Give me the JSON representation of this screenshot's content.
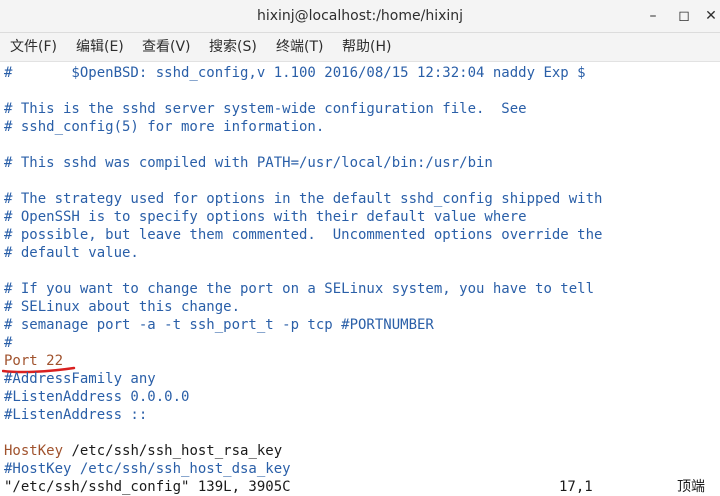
{
  "window": {
    "title": "hixinj@localhost:/home/hixinj",
    "minimize_glyph": "–",
    "maximize_glyph": "◻",
    "close_glyph": "✕"
  },
  "menu": {
    "items": [
      {
        "label": "文件(F)"
      },
      {
        "label": "编辑(E)"
      },
      {
        "label": "查看(V)"
      },
      {
        "label": "搜索(S)"
      },
      {
        "label": "终端(T)"
      },
      {
        "label": "帮助(H)"
      }
    ]
  },
  "editor": {
    "lines": [
      {
        "kind": "comment",
        "text": "#       $OpenBSD: sshd_config,v 1.100 2016/08/15 12:32:04 naddy Exp $"
      },
      {
        "kind": "blank",
        "text": ""
      },
      {
        "kind": "comment",
        "text": "# This is the sshd server system-wide configuration file.  See"
      },
      {
        "kind": "comment",
        "text": "# sshd_config(5) for more information."
      },
      {
        "kind": "blank",
        "text": ""
      },
      {
        "kind": "comment",
        "text": "# This sshd was compiled with PATH=/usr/local/bin:/usr/bin"
      },
      {
        "kind": "blank",
        "text": ""
      },
      {
        "kind": "comment",
        "text": "# The strategy used for options in the default sshd_config shipped with"
      },
      {
        "kind": "comment",
        "text": "# OpenSSH is to specify options with their default value where"
      },
      {
        "kind": "comment",
        "text": "# possible, but leave them commented.  Uncommented options override the"
      },
      {
        "kind": "comment",
        "text": "# default value."
      },
      {
        "kind": "blank",
        "text": ""
      },
      {
        "kind": "comment",
        "text": "# If you want to change the port on a SELinux system, you have to tell"
      },
      {
        "kind": "comment",
        "text": "# SELinux about this change."
      },
      {
        "kind": "comment",
        "text": "# semanage port -a -t ssh_port_t -p tcp #PORTNUMBER"
      },
      {
        "kind": "comment",
        "text": "#"
      },
      {
        "kind": "directive",
        "keyword": "Port 22",
        "value": ""
      },
      {
        "kind": "comment",
        "text": "#AddressFamily any"
      },
      {
        "kind": "comment",
        "text": "#ListenAddress 0.0.0.0"
      },
      {
        "kind": "comment",
        "text": "#ListenAddress ::"
      },
      {
        "kind": "blank",
        "text": ""
      },
      {
        "kind": "blank",
        "text": ""
      },
      {
        "kind": "directive",
        "keyword": "HostKey",
        "value": " /etc/ssh/ssh_host_rsa_key"
      },
      {
        "kind": "comment",
        "text": "#HostKey /etc/ssh/ssh_host_dsa_key"
      }
    ],
    "status": {
      "file_info": "\"/etc/ssh/sshd_config\" 139L, 3905C",
      "cursor": "17,1",
      "position": "顶端"
    }
  },
  "colors": {
    "comment": "#2a5fa8",
    "keyword": "#a0522d",
    "annotation": "#d92020"
  }
}
